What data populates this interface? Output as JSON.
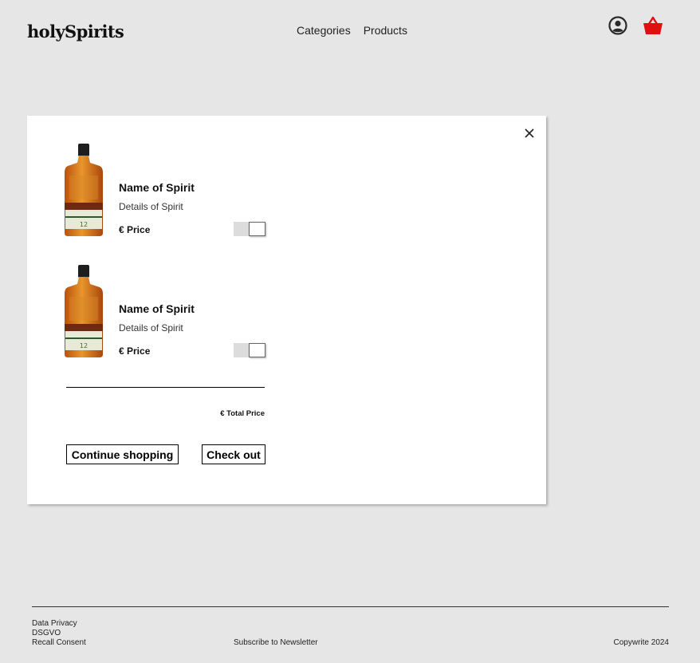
{
  "header": {
    "logo": "holySpirits",
    "nav": [
      "Categories",
      "Products"
    ],
    "icons": {
      "account": "user-circle-icon",
      "cart": "basket-icon"
    },
    "cart_color": "#e01010"
  },
  "cart_modal": {
    "close_icon": "close-icon",
    "items": [
      {
        "name": "Name of Spirit",
        "details": "Details of Spirit",
        "price": "€ Price"
      },
      {
        "name": "Name of Spirit",
        "details": "Details of Spirit",
        "price": "€ Price"
      }
    ],
    "total": "€ Total Price",
    "continue_label": "Continue shopping",
    "checkout_label": "Check out"
  },
  "footer": {
    "links": [
      "Data Privacy",
      "DSGVO",
      "Recall Consent"
    ],
    "newsletter": "Subscribe to Newsletter",
    "copyright": "Copywrite 2024"
  }
}
